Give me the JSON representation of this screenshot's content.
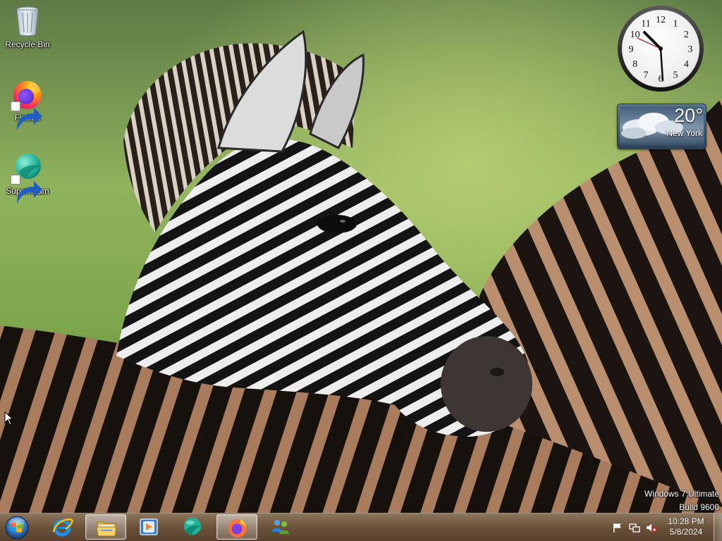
{
  "desktop": {
    "icons": [
      {
        "label": "Recycle Bin",
        "icon": "recycle-bin-icon"
      },
      {
        "label": "Firefox",
        "icon": "firefox-icon"
      },
      {
        "label": "Supermium",
        "icon": "supermium-icon"
      }
    ],
    "wallpaper": "zebra-wallpaper"
  },
  "gadgets": {
    "clock": {
      "numerals": [
        "12",
        "1",
        "2",
        "3",
        "4",
        "5",
        "6",
        "7",
        "8",
        "9",
        "10",
        "11"
      ]
    },
    "weather": {
      "temperature": "20°",
      "city": "New York",
      "icon": "cloudy-weather-icon"
    }
  },
  "watermark": {
    "line1": "Windows 7 Ultimate",
    "line2": "Build 9600"
  },
  "taskbar": {
    "start_icon": "windows-orb-icon",
    "pinned": [
      {
        "name": "internet-explorer",
        "icon": "internet-explorer-icon",
        "active": false
      },
      {
        "name": "file-explorer",
        "icon": "folder-icon",
        "active": true
      },
      {
        "name": "media-player",
        "icon": "media-player-icon",
        "active": false
      },
      {
        "name": "supermium",
        "icon": "supermium-icon",
        "active": false
      },
      {
        "name": "firefox",
        "icon": "firefox-icon",
        "active": true
      },
      {
        "name": "users",
        "icon": "users-icon",
        "active": false
      }
    ],
    "tray": {
      "time": "10:28 PM",
      "date": "5/8/2024",
      "icons": [
        "action-center-flag-icon",
        "network-icon",
        "volume-muted-icon"
      ]
    }
  },
  "colors": {
    "taskbar": "#6e4e3a",
    "firefox_orange": "#ff7139",
    "supermium_teal": "#21b39a"
  }
}
